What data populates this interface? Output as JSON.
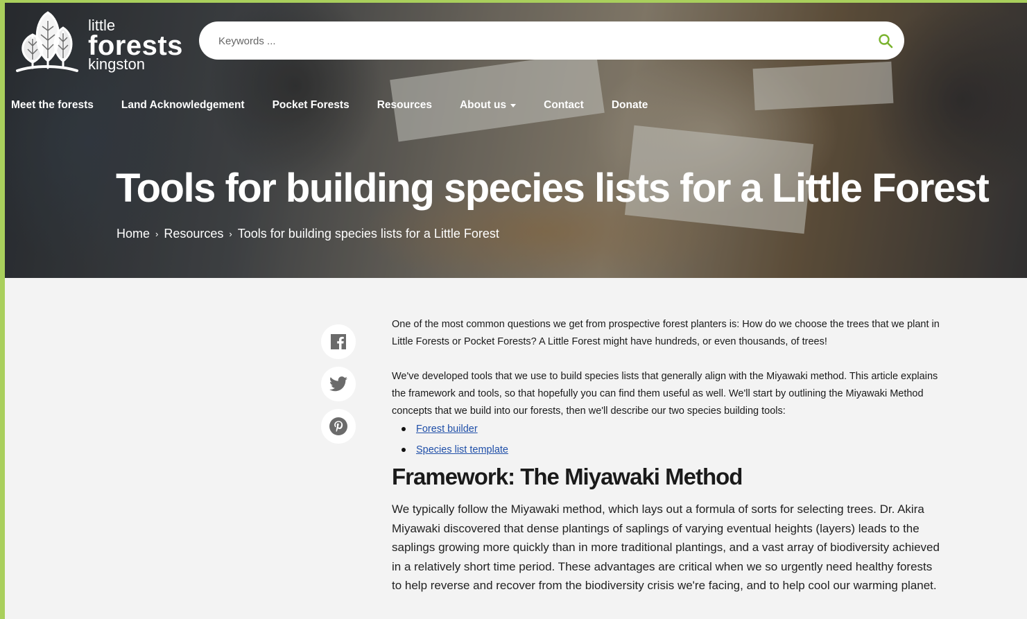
{
  "logo": {
    "line1": "little",
    "line2": "forests",
    "line3": "kingston"
  },
  "search": {
    "placeholder": "Keywords ...",
    "icon": "search-icon"
  },
  "nav": {
    "items": [
      {
        "label": "Meet the forests"
      },
      {
        "label": "Land Acknowledgement"
      },
      {
        "label": "Pocket Forests"
      },
      {
        "label": "Resources"
      },
      {
        "label": "About us",
        "has_dropdown": true
      },
      {
        "label": "Contact"
      },
      {
        "label": "Donate"
      }
    ]
  },
  "hero": {
    "title": "Tools for building species lists for a Little Forest",
    "breadcrumb": [
      "Home",
      "Resources",
      "Tools for building species lists for a Little Forest"
    ],
    "separator": "›"
  },
  "share": {
    "icons": [
      "facebook-icon",
      "twitter-icon",
      "pinterest-icon"
    ]
  },
  "article": {
    "p1": "One of the most common questions we get from prospective forest planters is: How do we choose the trees that we plant in Little Forests or Pocket Forests? A Little Forest might have hundreds, or even thousands, of trees!",
    "p2": "We've developed tools that we use to build species lists that generally align with the Miyawaki method. This article explains the framework and tools, so that hopefully you can find them useful as well. We'll start by outlining the Miyawaki Method concepts that we build into our forests, then we'll describe our two species building tools:",
    "links": [
      "Forest builder",
      "Species list template"
    ],
    "heading": "Framework: The Miyawaki Method",
    "p3": "We typically follow the Miyawaki method, which lays out a formula of sorts for selecting trees. Dr. Akira Miyawaki discovered that dense plantings of saplings of varying eventual heights (layers) leads to the saplings growing more quickly than in more traditional plantings, and a vast array of biodiversity achieved in a relatively short time period. These advantages are critical when we so urgently need healthy forests to help reverse and recover from the biodiversity crisis we're facing, and to help cool our warming planet."
  },
  "colors": {
    "accent_green": "#7ab32e",
    "link_blue": "#1f4fa8",
    "page_bg": "#f3f3f3",
    "border_green": "#a9cf5c"
  }
}
